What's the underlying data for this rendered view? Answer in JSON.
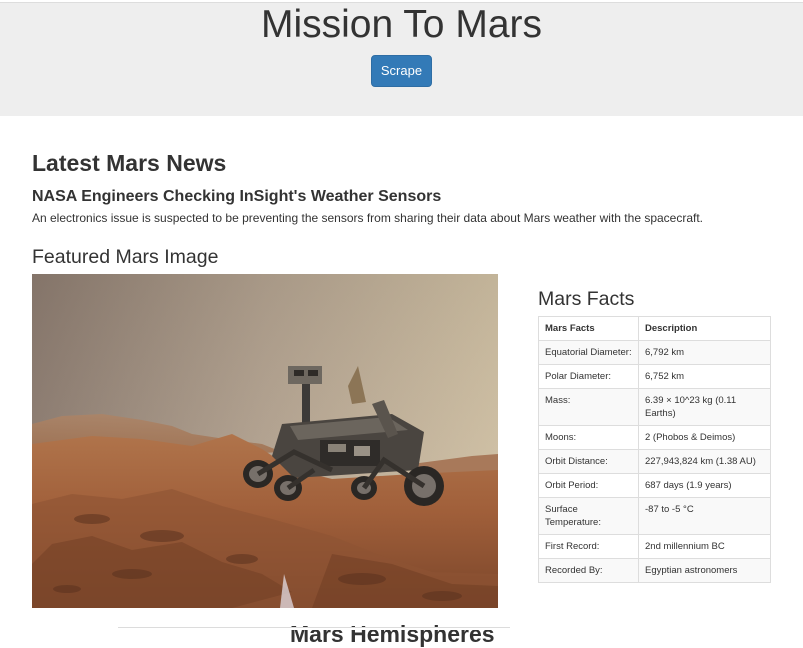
{
  "header": {
    "title": "Mission To Mars",
    "scrape_label": "Scrape"
  },
  "news": {
    "section_heading": "Latest Mars News",
    "title": "NASA Engineers Checking InSight's Weather Sensors",
    "paragraph": "An electronics issue is suspected to be preventing the sensors from sharing their data about Mars weather with the spacecraft."
  },
  "featured": {
    "heading": "Featured Mars Image"
  },
  "facts": {
    "heading": "Mars Facts",
    "columns": [
      "Mars Facts",
      "Description"
    ],
    "rows": [
      [
        "Equatorial Diameter:",
        "6,792 km"
      ],
      [
        "Polar Diameter:",
        "6,752 km"
      ],
      [
        "Mass:",
        "6.39 × 10^23 kg (0.11 Earths)"
      ],
      [
        "Moons:",
        "2 (Phobos & Deimos)"
      ],
      [
        "Orbit Distance:",
        "227,943,824 km (1.38 AU)"
      ],
      [
        "Orbit Period:",
        "687 days (1.9 years)"
      ],
      [
        "Surface Temperature:",
        "-87 to -5 °C"
      ],
      [
        "First Record:",
        "2nd millennium BC"
      ],
      [
        "Recorded By:",
        "Egyptian astronomers"
      ]
    ]
  },
  "hemispheres": {
    "heading": "Mars Hemispheres"
  }
}
